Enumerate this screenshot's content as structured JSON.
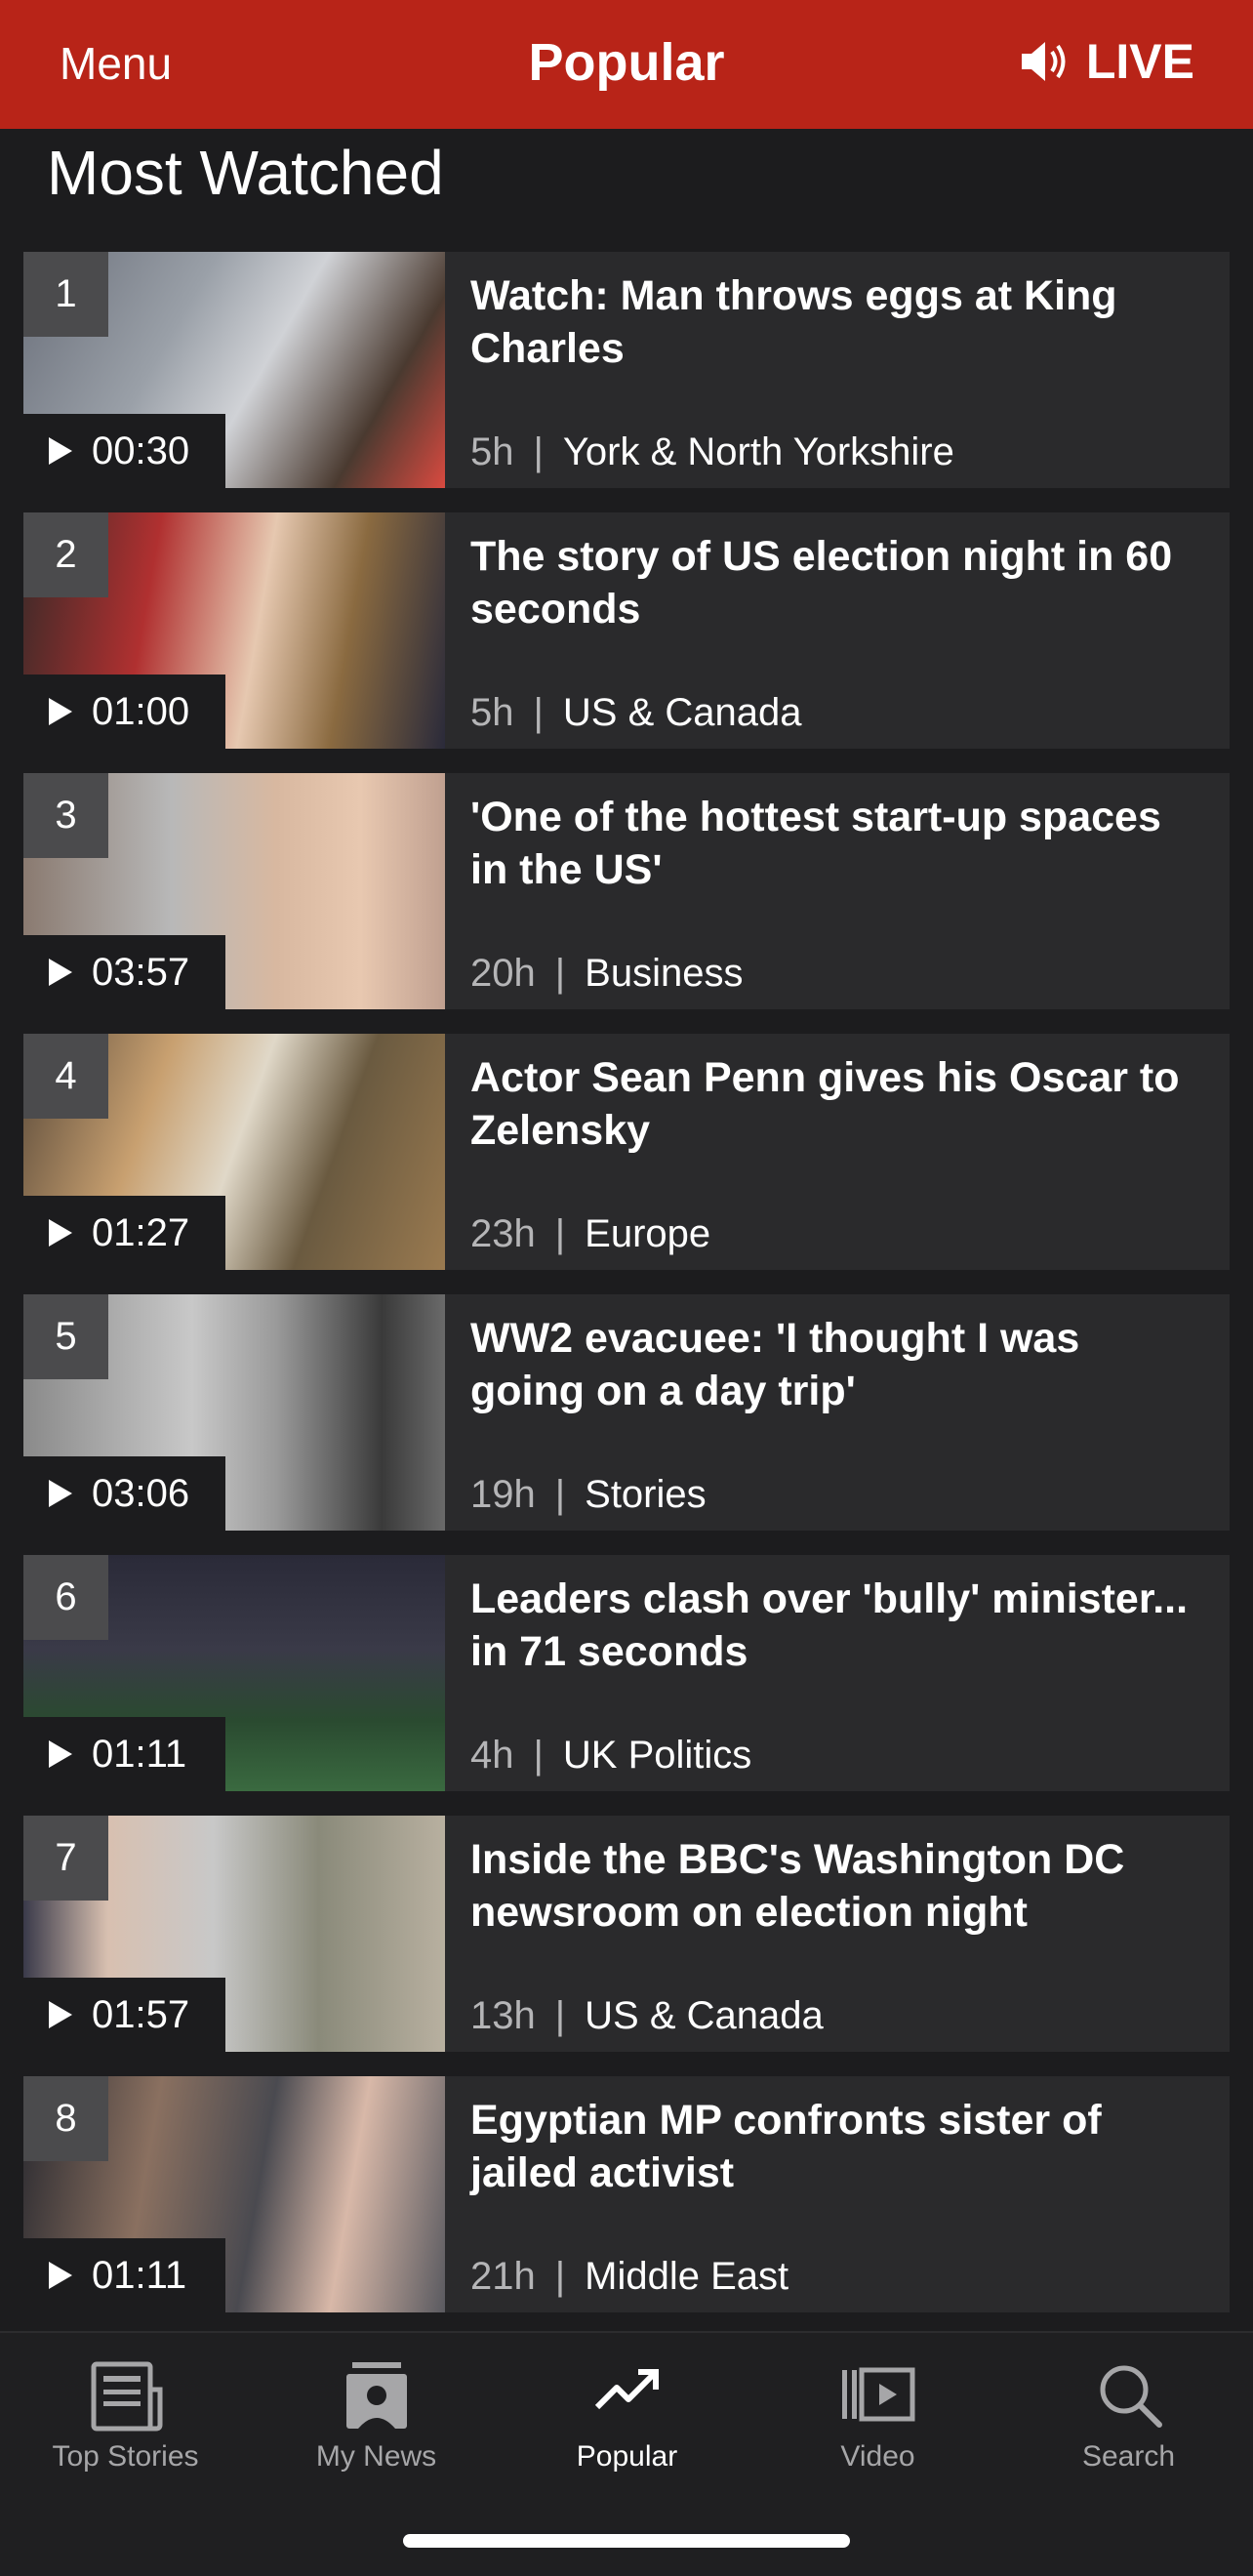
{
  "header": {
    "menu_label": "Menu",
    "title": "Popular",
    "live_label": "LIVE",
    "color": "#b82418"
  },
  "section": {
    "title": "Most Watched"
  },
  "items": [
    {
      "rank": "1",
      "duration": "00:30",
      "headline": "Watch: Man throws eggs at King Charles",
      "age": "5h",
      "category": "York & North Yorkshire"
    },
    {
      "rank": "2",
      "duration": "01:00",
      "headline": "The story of US election night in 60 seconds",
      "age": "5h",
      "category": "US & Canada"
    },
    {
      "rank": "3",
      "duration": "03:57",
      "headline": "'One of the hottest start-up spaces in the US'",
      "age": "20h",
      "category": "Business"
    },
    {
      "rank": "4",
      "duration": "01:27",
      "headline": "Actor Sean Penn gives his Oscar to Zelensky",
      "age": "23h",
      "category": "Europe"
    },
    {
      "rank": "5",
      "duration": "03:06",
      "headline": "WW2 evacuee: 'I thought I was going on a day trip'",
      "age": "19h",
      "category": "Stories"
    },
    {
      "rank": "6",
      "duration": "01:11",
      "headline": "Leaders clash over 'bully' minister... in 71 seconds",
      "age": "4h",
      "category": "UK Politics"
    },
    {
      "rank": "7",
      "duration": "01:57",
      "headline": "Inside the BBC's Washington DC newsroom on election night",
      "age": "13h",
      "category": "US & Canada"
    },
    {
      "rank": "8",
      "duration": "01:11",
      "headline": "Egyptian MP confronts sister of jailed activist",
      "age": "21h",
      "category": "Middle East"
    }
  ],
  "tabs": [
    {
      "label": "Top Stories",
      "icon": "newspaper-icon"
    },
    {
      "label": "My News",
      "icon": "person-feed-icon"
    },
    {
      "label": "Popular",
      "icon": "trending-icon",
      "active": true
    },
    {
      "label": "Video",
      "icon": "video-icon"
    },
    {
      "label": "Search",
      "icon": "search-icon"
    }
  ]
}
